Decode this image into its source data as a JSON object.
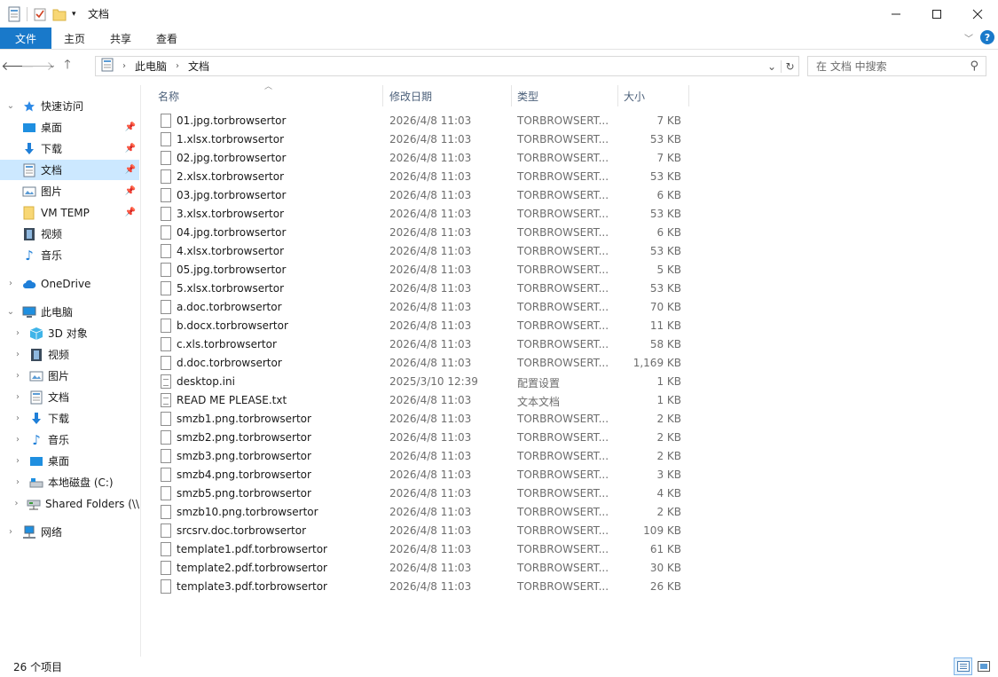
{
  "window": {
    "title": "文档"
  },
  "ribbon": {
    "tabs": [
      "文件",
      "主页",
      "共享",
      "查看"
    ]
  },
  "address": {
    "crumbs": [
      "此电脑",
      "文档"
    ]
  },
  "search": {
    "placeholder": "在 文档 中搜索"
  },
  "nav": {
    "quick_access": "快速访问",
    "items": [
      "桌面",
      "下载",
      "文档",
      "图片",
      "VM TEMP",
      "视频",
      "音乐"
    ],
    "onedrive": "OneDrive",
    "this_pc": "此电脑",
    "pc_items": [
      "3D 对象",
      "视频",
      "图片",
      "文档",
      "下载",
      "音乐",
      "桌面",
      "本地磁盘 (C:)",
      "Shared Folders (\\\\"
    ],
    "network": "网络"
  },
  "columns": {
    "name": "名称",
    "date": "修改日期",
    "type": "类型",
    "size": "大小"
  },
  "files": [
    {
      "name": "01.jpg.torbrowsertor",
      "date": "2026/4/8 11:03",
      "type": "TORBROWSERT...",
      "size": "7 KB"
    },
    {
      "name": "1.xlsx.torbrowsertor",
      "date": "2026/4/8 11:03",
      "type": "TORBROWSERT...",
      "size": "53 KB"
    },
    {
      "name": "02.jpg.torbrowsertor",
      "date": "2026/4/8 11:03",
      "type": "TORBROWSERT...",
      "size": "7 KB"
    },
    {
      "name": "2.xlsx.torbrowsertor",
      "date": "2026/4/8 11:03",
      "type": "TORBROWSERT...",
      "size": "53 KB"
    },
    {
      "name": "03.jpg.torbrowsertor",
      "date": "2026/4/8 11:03",
      "type": "TORBROWSERT...",
      "size": "6 KB"
    },
    {
      "name": "3.xlsx.torbrowsertor",
      "date": "2026/4/8 11:03",
      "type": "TORBROWSERT...",
      "size": "53 KB"
    },
    {
      "name": "04.jpg.torbrowsertor",
      "date": "2026/4/8 11:03",
      "type": "TORBROWSERT...",
      "size": "6 KB"
    },
    {
      "name": "4.xlsx.torbrowsertor",
      "date": "2026/4/8 11:03",
      "type": "TORBROWSERT...",
      "size": "53 KB"
    },
    {
      "name": "05.jpg.torbrowsertor",
      "date": "2026/4/8 11:03",
      "type": "TORBROWSERT...",
      "size": "5 KB"
    },
    {
      "name": "5.xlsx.torbrowsertor",
      "date": "2026/4/8 11:03",
      "type": "TORBROWSERT...",
      "size": "53 KB"
    },
    {
      "name": "a.doc.torbrowsertor",
      "date": "2026/4/8 11:03",
      "type": "TORBROWSERT...",
      "size": "70 KB"
    },
    {
      "name": "b.docx.torbrowsertor",
      "date": "2026/4/8 11:03",
      "type": "TORBROWSERT...",
      "size": "11 KB"
    },
    {
      "name": "c.xls.torbrowsertor",
      "date": "2026/4/8 11:03",
      "type": "TORBROWSERT...",
      "size": "58 KB"
    },
    {
      "name": "d.doc.torbrowsertor",
      "date": "2026/4/8 11:03",
      "type": "TORBROWSERT...",
      "size": "1,169 KB"
    },
    {
      "name": "desktop.ini",
      "date": "2025/3/10 12:39",
      "type": "配置设置",
      "size": "1 KB"
    },
    {
      "name": "READ ME PLEASE.txt",
      "date": "2026/4/8 11:03",
      "type": "文本文档",
      "size": "1 KB"
    },
    {
      "name": "smzb1.png.torbrowsertor",
      "date": "2026/4/8 11:03",
      "type": "TORBROWSERT...",
      "size": "2 KB"
    },
    {
      "name": "smzb2.png.torbrowsertor",
      "date": "2026/4/8 11:03",
      "type": "TORBROWSERT...",
      "size": "2 KB"
    },
    {
      "name": "smzb3.png.torbrowsertor",
      "date": "2026/4/8 11:03",
      "type": "TORBROWSERT...",
      "size": "2 KB"
    },
    {
      "name": "smzb4.png.torbrowsertor",
      "date": "2026/4/8 11:03",
      "type": "TORBROWSERT...",
      "size": "3 KB"
    },
    {
      "name": "smzb5.png.torbrowsertor",
      "date": "2026/4/8 11:03",
      "type": "TORBROWSERT...",
      "size": "4 KB"
    },
    {
      "name": "smzb10.png.torbrowsertor",
      "date": "2026/4/8 11:03",
      "type": "TORBROWSERT...",
      "size": "2 KB"
    },
    {
      "name": "srcsrv.doc.torbrowsertor",
      "date": "2026/4/8 11:03",
      "type": "TORBROWSERT...",
      "size": "109 KB"
    },
    {
      "name": "template1.pdf.torbrowsertor",
      "date": "2026/4/8 11:03",
      "type": "TORBROWSERT...",
      "size": "61 KB"
    },
    {
      "name": "template2.pdf.torbrowsertor",
      "date": "2026/4/8 11:03",
      "type": "TORBROWSERT...",
      "size": "30 KB"
    },
    {
      "name": "template3.pdf.torbrowsertor",
      "date": "2026/4/8 11:03",
      "type": "TORBROWSERT...",
      "size": "26 KB"
    }
  ],
  "status": {
    "count": "26 个项目"
  },
  "colors": {
    "accent": "#1979ca",
    "selected": "#cce8ff",
    "header_text": "#4c607a"
  }
}
